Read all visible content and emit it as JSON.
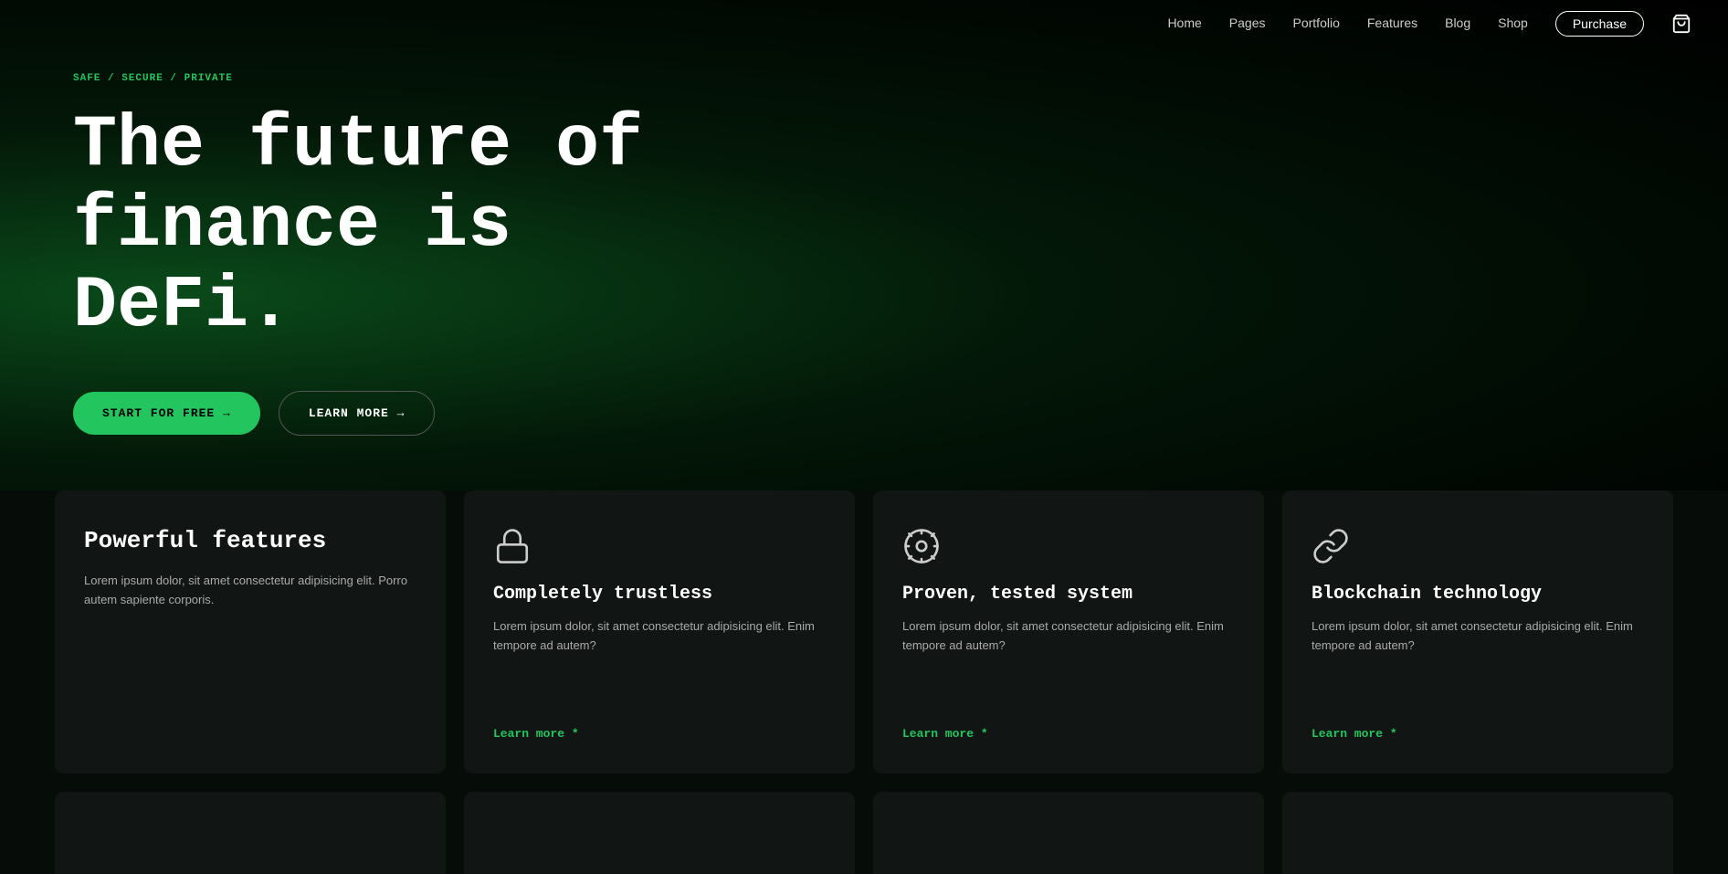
{
  "nav": {
    "links": [
      {
        "label": "Home",
        "id": "home"
      },
      {
        "label": "Pages",
        "id": "pages"
      },
      {
        "label": "Portfolio",
        "id": "portfolio"
      },
      {
        "label": "Features",
        "id": "features"
      },
      {
        "label": "Blog",
        "id": "blog"
      },
      {
        "label": "Shop",
        "id": "shop"
      }
    ],
    "purchase_label": "Purchase",
    "cart_icon": "cart"
  },
  "hero": {
    "eyebrow": "SAFE / SECURE / PRIVATE",
    "title_line1": "The future of",
    "title_line2": "finance is DeFi.",
    "btn_primary": "START FOR FREE →",
    "btn_secondary": "LEARN MORE →"
  },
  "cards": [
    {
      "id": "powerful-features",
      "icon": null,
      "title": "Powerful features",
      "text": "Lorem ipsum dolor, sit amet consectetur adipisicing elit. Porro autem sapiente corporis.",
      "link": null
    },
    {
      "id": "trustless",
      "icon": "lock",
      "title": "Completely trustless",
      "text": "Lorem ipsum dolor, sit amet consectetur adipisicing elit. Enim tempore ad autem?",
      "link": "Learn more *"
    },
    {
      "id": "tested-system",
      "icon": "gear-circle",
      "title": "Proven, tested system",
      "text": "Lorem ipsum dolor, sit amet consectetur adipisicing elit. Enim tempore ad autem?",
      "link": "Learn more *"
    },
    {
      "id": "blockchain",
      "icon": "chain",
      "title": "Blockchain technology",
      "text": "Lorem ipsum dolor, sit amet consectetur adipisicing elit. Enim tempore ad autem?",
      "link": "Learn more *"
    }
  ],
  "colors": {
    "green": "#22c55e",
    "dark_bg": "#111614",
    "hero_bg_start": "#0a4a1a"
  }
}
